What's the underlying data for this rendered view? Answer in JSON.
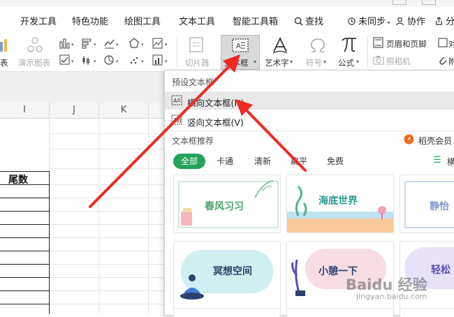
{
  "menu": {
    "tabs": [
      "开发工具",
      "特色功能",
      "绘图工具",
      "文本工具",
      "智能工具箱",
      "查找"
    ],
    "sync": "未同步",
    "collab": "协作",
    "share": "分"
  },
  "ribbon": {
    "chart_partial": "表",
    "demo_chart": "演示图表",
    "slicer": "切片器",
    "textbox": "文本框",
    "wordart": "艺术字",
    "symbol": "符号",
    "formula": "公式",
    "header_footer": "页眉和页脚",
    "camera": "照相机",
    "right_partial_1": "对",
    "right_partial_2": "附"
  },
  "sheet": {
    "columns": [
      "I",
      "J",
      "K"
    ],
    "header_cell": "尾数"
  },
  "dropdown": {
    "preset_title": "预设文本框",
    "horizontal": "横向文本框(H)",
    "vertical": "竖向文本框(V)",
    "recommend_title": "文本框推荐",
    "vip": "稻壳会员",
    "categories": [
      "全部",
      "卡通",
      "清新",
      "扁平",
      "免费"
    ],
    "right_partial": "横",
    "cards": [
      "春风习习",
      "海底世界",
      "静怡",
      "冥想空间",
      "小憩一下",
      "轻松"
    ]
  },
  "watermark": "Baidu 经验",
  "watermark_url": "jingyan.baidu.com",
  "colors": {
    "accent_green": "#26a35a",
    "annotation_red": "#ee2a22",
    "vip_orange": "#f26a1b",
    "teal_text": "#2a9d8f"
  }
}
